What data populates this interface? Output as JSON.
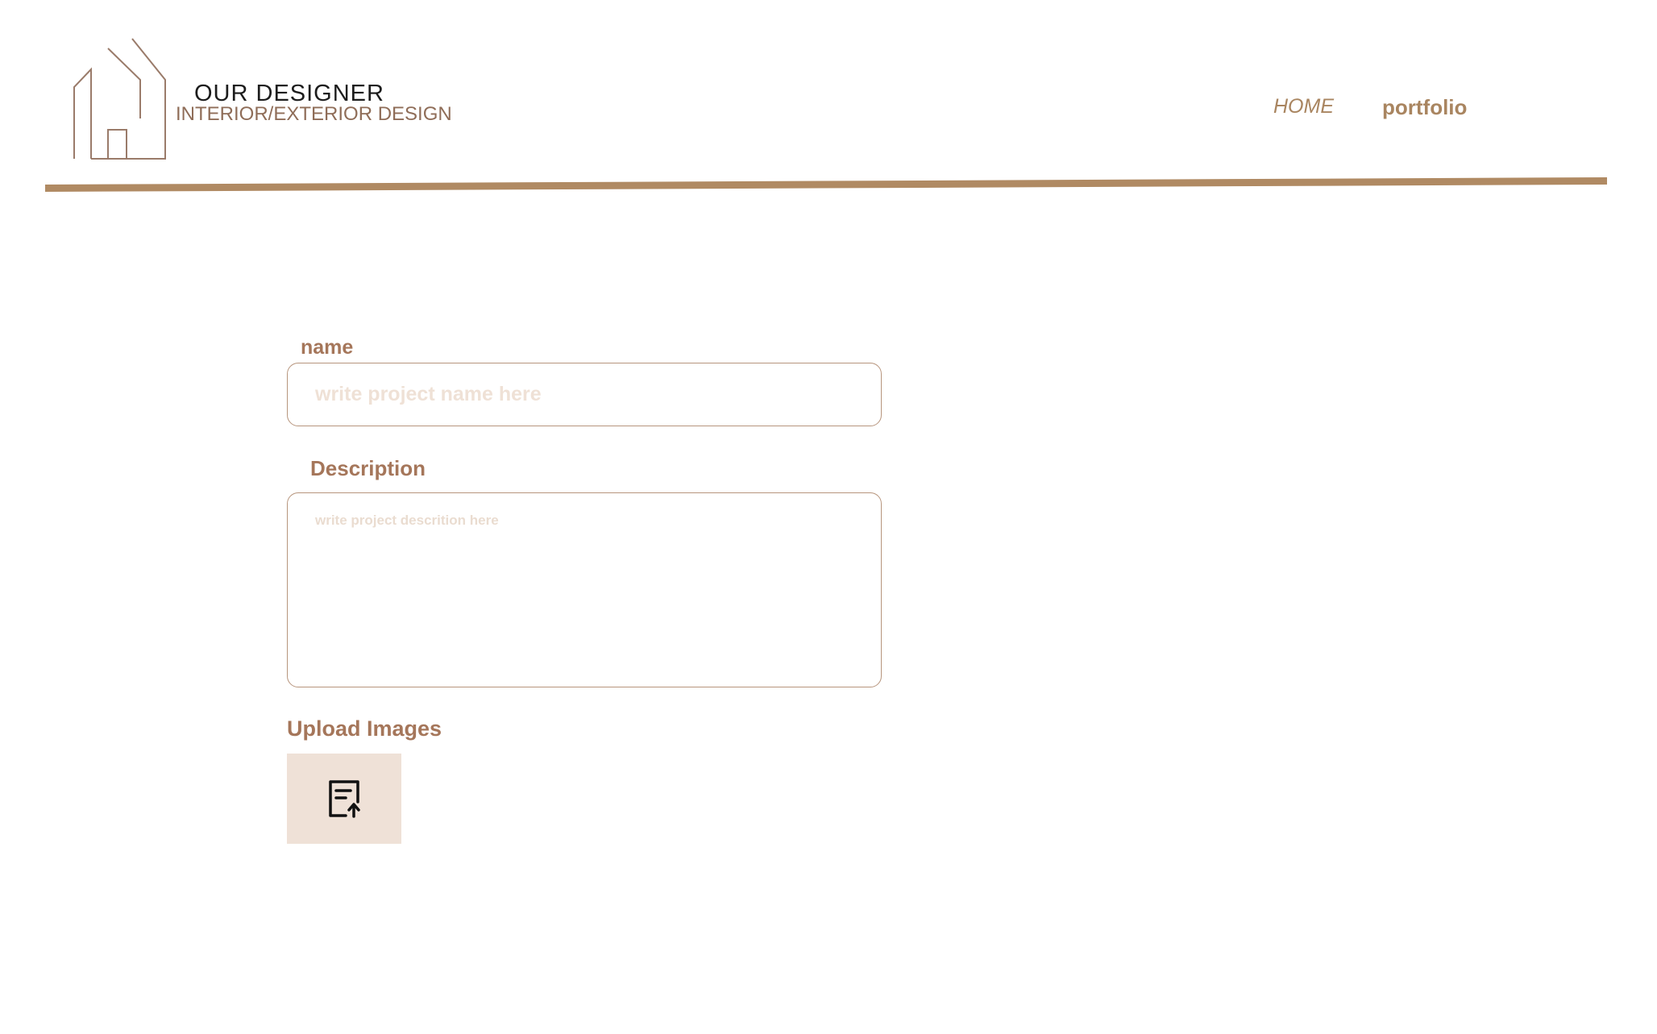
{
  "header": {
    "brand": {
      "title": "OUR DESIGNER",
      "subtitle": "INTERIOR/EXTERIOR DESIGN",
      "logo_icon": "house-outline-icon"
    },
    "nav": {
      "home_label": "HOME",
      "portfolio_label": "portfolio"
    },
    "divider_color": "#b08a63"
  },
  "form": {
    "name": {
      "label": "name",
      "placeholder": "write project name here",
      "value": ""
    },
    "description": {
      "label": "Description",
      "placeholder": "write project descrition here",
      "value": ""
    },
    "upload": {
      "label": "Upload Images",
      "icon": "file-upload-icon"
    }
  },
  "colors": {
    "accent": "#a98560",
    "label": "#a5765a",
    "border": "#b7957d",
    "placeholder": "#efe1d6",
    "upload_bg": "#efe1d7"
  }
}
